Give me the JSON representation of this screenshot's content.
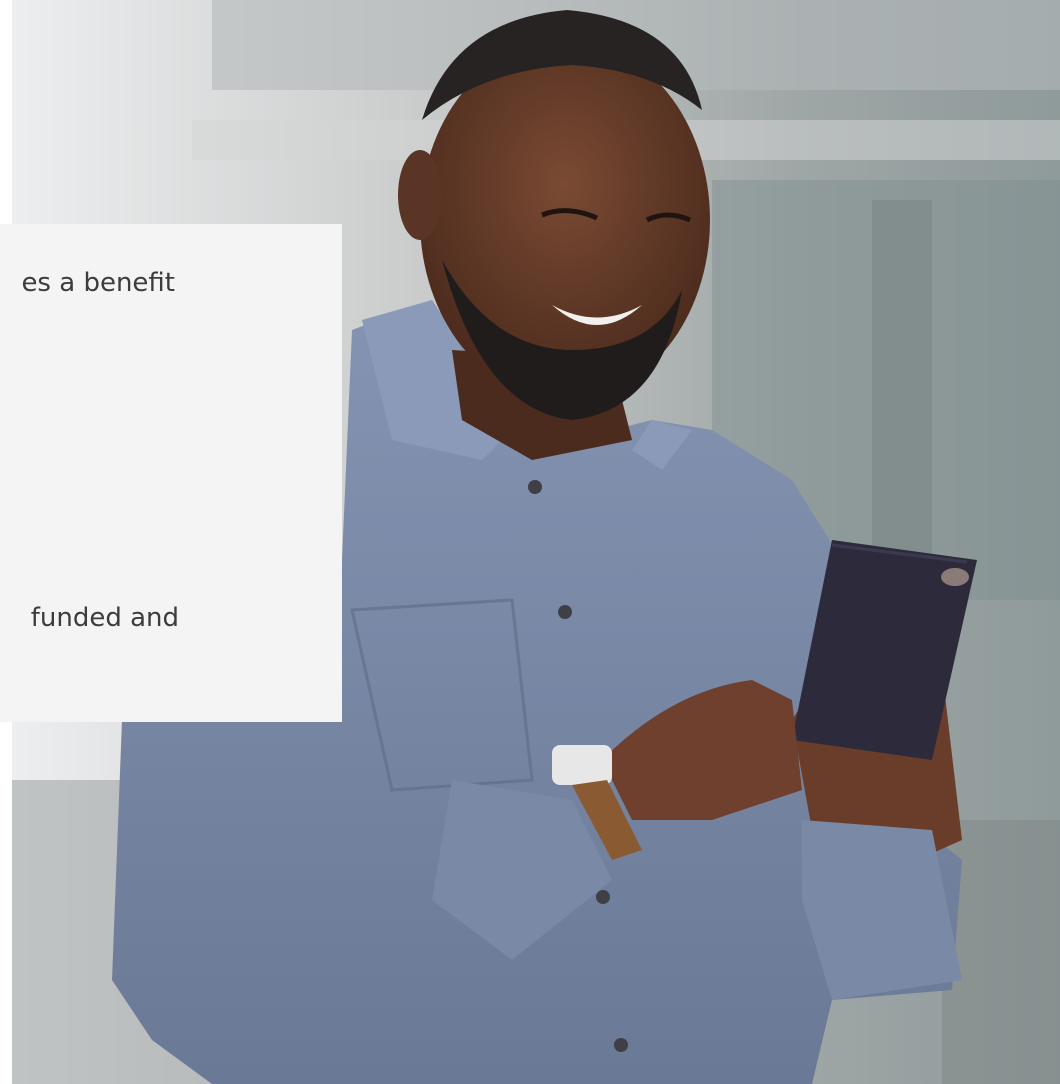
{
  "card": {
    "text_line_1": "es a benefit",
    "text_line_2": "funded and"
  },
  "colors": {
    "card_background": "#f4f4f4",
    "card_text": "#3c3c3c",
    "shirt": "#7a8aa6"
  },
  "image": {
    "subject": "photo-man-smiling-phone"
  }
}
